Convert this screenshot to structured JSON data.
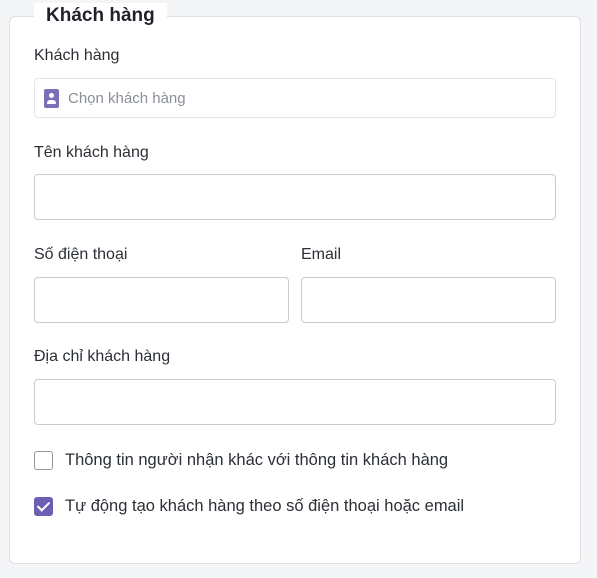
{
  "section": {
    "title": "Khách hàng"
  },
  "customer_select": {
    "label": "Khách hàng",
    "placeholder": "Chọn khách hàng",
    "icon": "contact-card-icon"
  },
  "customer_name": {
    "label": "Tên khách hàng",
    "value": ""
  },
  "phone": {
    "label": "Số điện thoại",
    "value": ""
  },
  "email": {
    "label": "Email",
    "value": ""
  },
  "address": {
    "label": "Địa chỉ khách hàng",
    "value": ""
  },
  "options": {
    "different_recipient": {
      "label": "Thông tin người nhận khác với thông tin khách hàng",
      "checked": false
    },
    "auto_create": {
      "label": "Tự động tạo khách hàng theo số điện thoại hoặc email",
      "checked": true
    }
  },
  "colors": {
    "accent": "#6b5fb5",
    "icon": "#7b6fb8",
    "border": "#c8ccd2"
  }
}
